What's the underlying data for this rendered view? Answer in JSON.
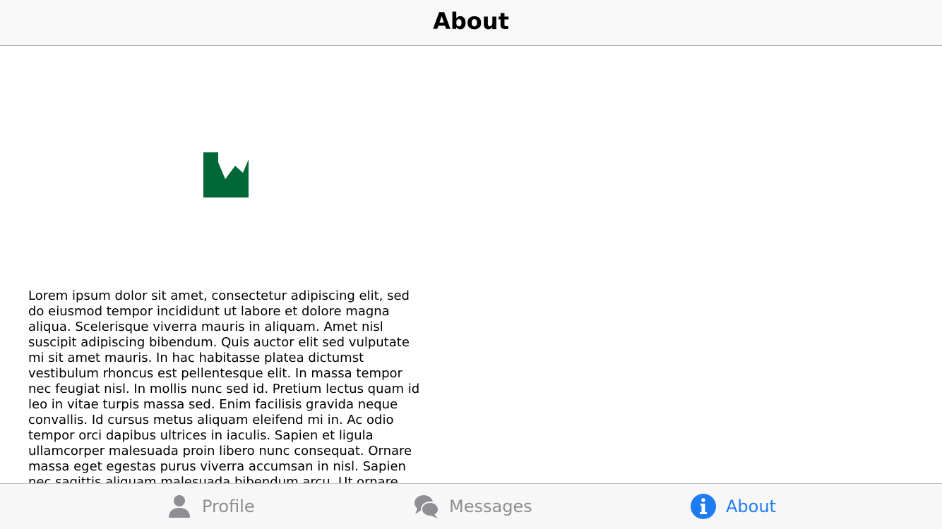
{
  "nav": {
    "title": "About"
  },
  "about": {
    "logo": {
      "icon": "rw-logo",
      "color": "#006837"
    },
    "body": "Lorem ipsum dolor sit amet, consectetur adipiscing elit, sed do eiusmod tempor incididunt ut labore et dolore magna aliqua. Scelerisque viverra mauris in aliquam. Amet nisl suscipit adipiscing bibendum. Quis auctor elit sed vulputate mi sit amet mauris. In hac habitasse platea dictumst vestibulum rhoncus est pellentesque elit. In massa tempor nec feugiat nisl. In mollis nunc sed id. Pretium lectus quam id leo in vitae turpis massa sed. Enim facilisis gravida neque convallis. Id cursus metus aliquam eleifend mi in. Ac odio tempor orci dapibus ultrices in iaculis. Sapien et ligula ullamcorper malesuada proin libero nunc consequat. Ornare massa eget egestas purus viverra accumsan in nisl. Sapien nec sagittis aliquam malesuada bibendum arcu. Ut ornare"
  },
  "tabs": [
    {
      "label": "Profile",
      "icon": "person-icon",
      "active": false
    },
    {
      "label": "Messages",
      "icon": "chat-bubbles-icon",
      "active": false
    },
    {
      "label": "About",
      "icon": "info-icon",
      "active": true
    }
  ],
  "colors": {
    "accent": "#1e7cf2",
    "inactive": "#8e8e93",
    "logo": "#006837"
  }
}
